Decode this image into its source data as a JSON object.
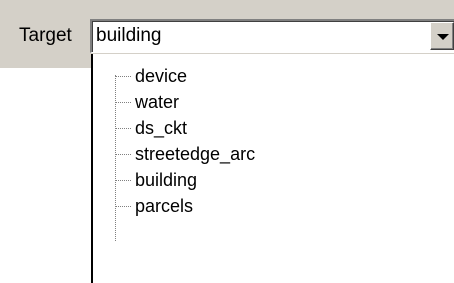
{
  "target": {
    "label": "Target",
    "value": "building"
  },
  "dropdown": {
    "items": [
      {
        "label": "device"
      },
      {
        "label": "water"
      },
      {
        "label": "ds_ckt"
      },
      {
        "label": "streetedge_arc"
      },
      {
        "label": "building"
      },
      {
        "label": "parcels"
      }
    ]
  },
  "icons": {
    "combo_arrow": "chevron-down-icon"
  }
}
